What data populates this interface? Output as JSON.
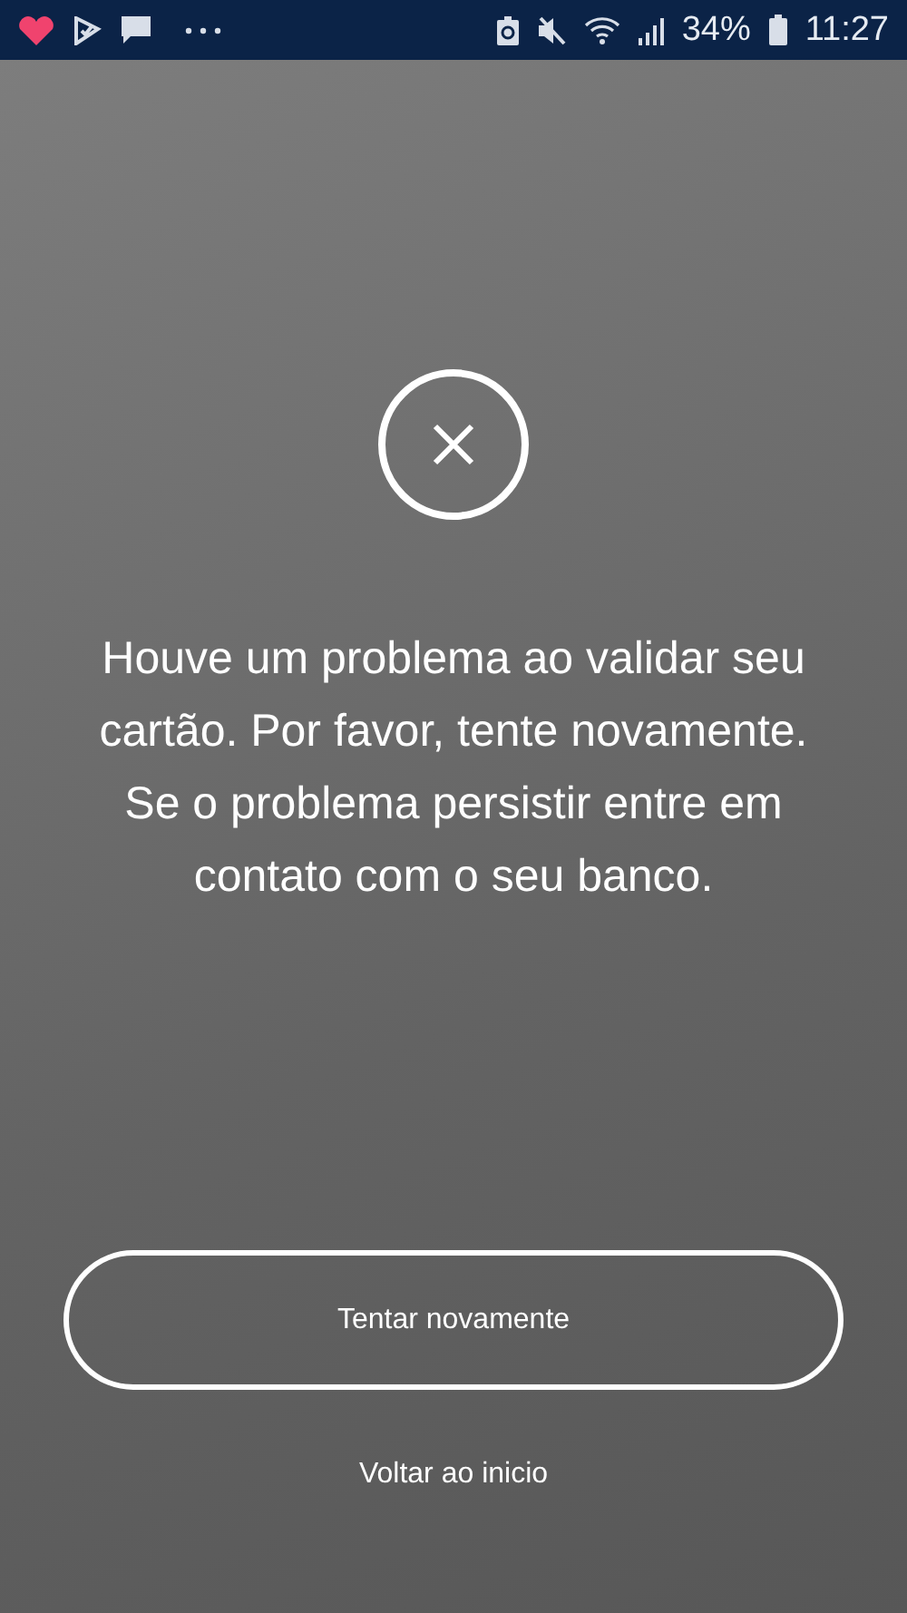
{
  "status_bar": {
    "battery": "34%",
    "time": "11:27"
  },
  "message": "Houve um problema ao validar seu cartão. Por favor, tente novamente. Se o problema persistir entre em contato com o seu banco.",
  "retry_button": {
    "label": "Tentar novamente"
  },
  "back_link": {
    "label": "Voltar ao inicio"
  }
}
